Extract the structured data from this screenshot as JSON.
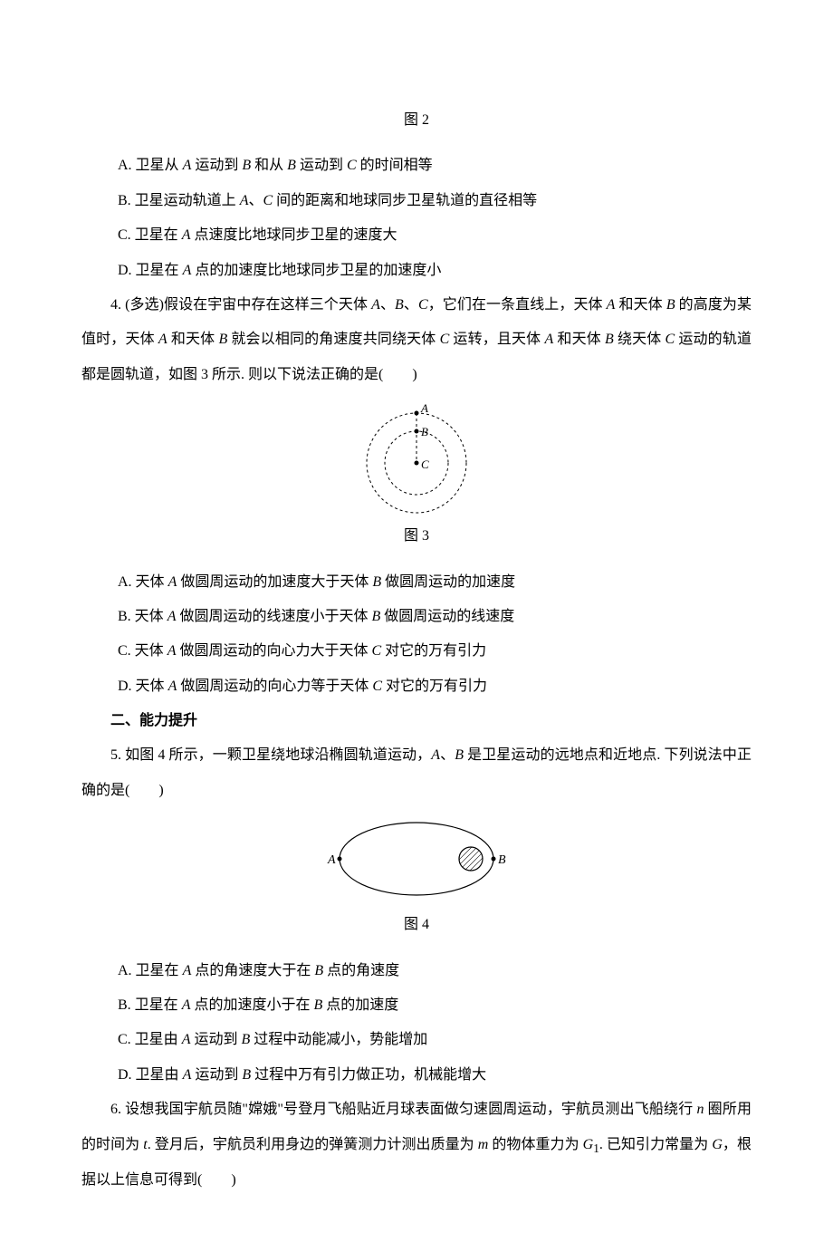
{
  "fig2": {
    "caption": "图 2",
    "optA_pre": "A. 卫星从 ",
    "optA_a": "A",
    "optA_mid1": " 运动到 ",
    "optA_b": "B",
    "optA_mid2": " 和从 ",
    "optA_b2": "B",
    "optA_mid3": " 运动到 ",
    "optA_c": "C",
    "optA_post": " 的时间相等",
    "optB_pre": "B. 卫星运动轨道上 ",
    "optB_a": "A",
    "optB_sep": "、",
    "optB_c": "C",
    "optB_post": " 间的距离和地球同步卫星轨道的直径相等",
    "optC_pre": "C. 卫星在 ",
    "optC_a": "A",
    "optC_post": " 点速度比地球同步卫星的速度大",
    "optD_pre": "D. 卫星在 ",
    "optD_a": "A",
    "optD_post": " 点的加速度比地球同步卫星的加速度小"
  },
  "q4": {
    "pre": "4. (多选)假设在宇宙中存在这样三个天体 ",
    "a": "A",
    "s1": "、",
    "b": "B",
    "s2": "、",
    "c": "C",
    "mid1": "，它们在一条直线上，天体 ",
    "a2": "A",
    "mid2": " 和天体 ",
    "b2": "B",
    "mid3": " 的高度为某值时，天体 ",
    "a3": "A",
    "mid4": " 和天体 ",
    "b3": "B",
    "mid5": " 就会以相同的角速度共同绕天体 ",
    "c2": "C",
    "mid6": " 运转，且天体 ",
    "a4": "A",
    "mid7": " 和天体 ",
    "b4": "B",
    "mid8": " 绕天体 ",
    "c3": "C",
    "mid9": " 运动的轨道都是圆轨道，如图 3 所示. 则以下说法正确的是(　　)",
    "caption": "图 3",
    "labelA": "A",
    "labelB": "B",
    "labelC": "C",
    "optA_pre": "A. 天体 ",
    "optA_a": "A",
    "optA_mid": " 做圆周运动的加速度大于天体 ",
    "optA_b": "B",
    "optA_post": " 做圆周运动的加速度",
    "optB_pre": "B. 天体 ",
    "optB_a": "A",
    "optB_mid": " 做圆周运动的线速度小于天体 ",
    "optB_b": "B",
    "optB_post": " 做圆周运动的线速度",
    "optC_pre": "C. 天体 ",
    "optC_a": "A",
    "optC_mid": " 做圆周运动的向心力大于天体 ",
    "optC_b": "C",
    "optC_post": " 对它的万有引力",
    "optD_pre": "D. 天体 ",
    "optD_a": "A",
    "optD_mid": " 做圆周运动的向心力等于天体 ",
    "optD_b": "C",
    "optD_post": " 对它的万有引力"
  },
  "section2": "二、能力提升",
  "q5": {
    "pre": "5. 如图 4 所示，一颗卫星绕地球沿椭圆轨道运动，",
    "a": "A",
    "s1": "、",
    "b": "B",
    "post": " 是卫星运动的远地点和近地点. 下列说法中正确的是(　　)",
    "caption": "图 4",
    "labelA": "A",
    "labelB": "B",
    "optA_pre": "A. 卫星在 ",
    "optA_a": "A",
    "optA_mid": " 点的角速度大于在 ",
    "optA_b": "B",
    "optA_post": " 点的角速度",
    "optB_pre": "B. 卫星在 ",
    "optB_a": "A",
    "optB_mid": " 点的加速度小于在 ",
    "optB_b": "B",
    "optB_post": " 点的加速度",
    "optC_pre": "C. 卫星由 ",
    "optC_a": "A",
    "optC_mid": " 运动到 ",
    "optC_b": "B",
    "optC_post": " 过程中动能减小，势能增加",
    "optD_pre": "D. 卫星由 ",
    "optD_a": "A",
    "optD_mid": " 运动到 ",
    "optD_b": "B",
    "optD_post": " 过程中万有引力做正功，机械能增大"
  },
  "q6": {
    "pre": "6. 设想我国宇航员随\"嫦娥\"号登月飞船贴近月球表面做匀速圆周运动，宇航员测出飞船绕行 ",
    "n": "n",
    "mid1": " 圈所用的时间为 ",
    "t": "t",
    "mid2": ". 登月后，宇航员利用身边的弹簧测力计测出质量为 ",
    "m": "m",
    "mid3": " 的物体重力为 ",
    "g1": "G",
    "g1sub": "1",
    "mid4": ". 已知引力常量为 ",
    "g": "G",
    "post": "，根据以上信息可得到(　　)"
  }
}
